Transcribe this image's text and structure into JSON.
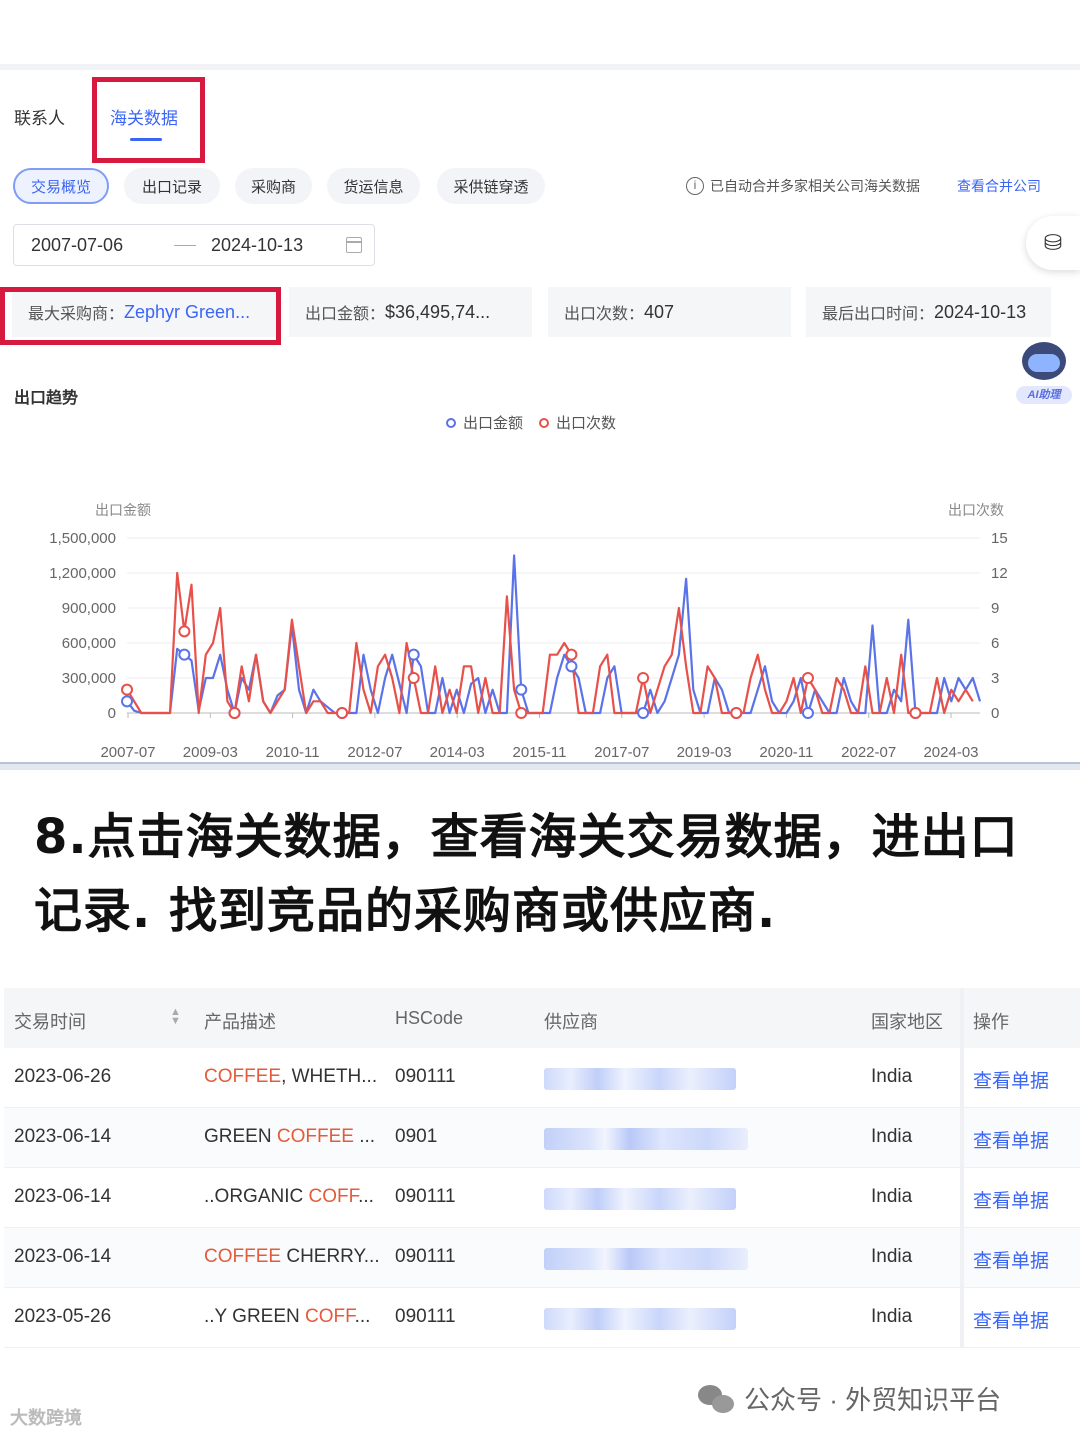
{
  "tabs": {
    "contacts": "联系人",
    "customs": "海关数据"
  },
  "subtabs": [
    "交易概览",
    "出口记录",
    "采购商",
    "货运信息",
    "采供链穿透"
  ],
  "notice": {
    "text": "已自动合并多家相关公司海关数据",
    "link": "查看合并公司",
    "icon": "info-icon"
  },
  "date_range": {
    "start": "2007-07-06",
    "end": "2024-10-13",
    "icon": "calendar-icon"
  },
  "stats": {
    "top_buyer_label": "最大采购商：",
    "top_buyer_value": "Zephyr Green...",
    "amount_label": "出口金额：",
    "amount_value": "$36,495,74...",
    "count_label": "出口次数：",
    "count_value": "407",
    "last_label": "最后出口时间：",
    "last_value": "2024-10-13"
  },
  "ai_assistant": "AI助理",
  "trend_title": "出口趋势",
  "chart_data": {
    "type": "line",
    "legend": [
      "出口金额",
      "出口次数"
    ],
    "ylabel_left": "出口金额",
    "ylabel_right": "出口次数",
    "yticks_left": [
      "0",
      "300,000",
      "600,000",
      "900,000",
      "1,200,000",
      "1,500,000"
    ],
    "yticks_right": [
      "0",
      "3",
      "6",
      "9",
      "12",
      "15"
    ],
    "xticks": [
      "2007-07",
      "2009-03",
      "2010-11",
      "2012-07",
      "2014-03",
      "2015-11",
      "2017-07",
      "2019-03",
      "2020-11",
      "2022-07",
      "2024-03"
    ],
    "ylim_left": [
      0,
      1500000
    ],
    "ylim_right": [
      0,
      15
    ],
    "colors": {
      "amount": "#5b73e8",
      "count": "#e8504a"
    },
    "series": [
      {
        "name": "出口金额",
        "values": [
          100000,
          20000,
          0,
          0,
          0,
          0,
          0,
          550000,
          500000,
          450000,
          20000,
          300000,
          300000,
          500000,
          200000,
          0,
          300000,
          200000,
          500000,
          100000,
          0,
          150000,
          200000,
          750000,
          200000,
          0,
          200000,
          100000,
          50000,
          0,
          0,
          0,
          0,
          500000,
          200000,
          0,
          300000,
          500000,
          250000,
          0,
          500000,
          400000,
          0,
          0,
          300000,
          0,
          200000,
          0,
          250000,
          300000,
          0,
          200000,
          0,
          0,
          1350000,
          200000,
          0,
          0,
          0,
          0,
          300000,
          500000,
          400000,
          300000,
          0,
          0,
          0,
          300000,
          400000,
          0,
          0,
          0,
          0,
          200000,
          0,
          100000,
          300000,
          500000,
          1150000,
          200000,
          0,
          0,
          300000,
          200000,
          0,
          0,
          0,
          0,
          200000,
          400000,
          100000,
          0,
          0,
          100000,
          300000,
          0,
          200000,
          100000,
          0,
          0,
          300000,
          100000,
          0,
          0,
          750000,
          0,
          0,
          200000,
          100000,
          800000,
          0,
          0,
          0,
          0,
          300000,
          100000,
          300000,
          200000,
          300000,
          100000
        ]
      },
      {
        "name": "出口次数",
        "values": [
          2,
          1,
          0,
          0,
          0,
          0,
          0,
          12,
          7,
          11,
          0,
          5,
          6,
          9,
          1,
          0,
          4,
          1,
          5,
          1,
          0,
          1,
          2,
          8,
          4,
          0,
          1,
          1,
          0,
          0,
          0,
          0,
          6,
          2,
          0,
          4,
          5,
          3,
          0,
          6,
          3,
          0,
          0,
          4,
          0,
          2,
          0,
          4,
          4,
          0,
          3,
          0,
          0,
          10,
          2,
          0,
          0,
          0,
          0,
          5,
          5,
          6,
          5,
          0,
          0,
          0,
          4,
          5,
          0,
          0,
          0,
          0,
          3,
          0,
          2,
          4,
          5,
          9,
          4,
          0,
          0,
          4,
          3,
          0,
          0,
          0,
          0,
          3,
          5,
          2,
          0,
          0,
          1,
          3,
          0,
          3,
          2,
          0,
          0,
          3,
          2,
          0,
          0,
          4,
          0,
          0,
          3,
          0,
          5,
          0,
          0,
          0,
          0,
          3,
          0,
          2,
          1,
          2,
          1
        ]
      }
    ]
  },
  "caption": {
    "line1": "8.点击海关数据，查看海关交易数据，进出口",
    "line2": "记录. 找到竞品的采购商或供应商."
  },
  "table": {
    "headers": [
      "交易时间",
      "产品描述",
      "HSCode",
      "供应商",
      "国家地区",
      "操作"
    ],
    "rows": [
      {
        "date": "2023-06-26",
        "desc_hl": "COFFEE",
        "desc_rest": ", WHETH...",
        "desc_pre": "",
        "hs": "090111",
        "country": "India",
        "op": "查看单据"
      },
      {
        "date": "2023-06-14",
        "desc_pre": "GREEN ",
        "desc_hl": "COFFEE",
        "desc_rest": " ...",
        "hs": "0901",
        "country": "India",
        "op": "查看单据"
      },
      {
        "date": "2023-06-14",
        "desc_pre": "..ORGANIC ",
        "desc_hl": "COFF",
        "desc_rest": "...",
        "hs": "090111",
        "country": "India",
        "op": "查看单据"
      },
      {
        "date": "2023-06-14",
        "desc_pre": "",
        "desc_hl": "COFFEE",
        "desc_rest": " CHERRY...",
        "hs": "090111",
        "country": "India",
        "op": "查看单据"
      },
      {
        "date": "2023-05-26",
        "desc_pre": "..Y GREEN ",
        "desc_hl": "COFF",
        "desc_rest": "...",
        "hs": "090111",
        "country": "India",
        "op": "查看单据"
      }
    ]
  },
  "footer": {
    "left_logo": "大数跨境",
    "wechat": "公众号 · 外贸知识平台"
  }
}
